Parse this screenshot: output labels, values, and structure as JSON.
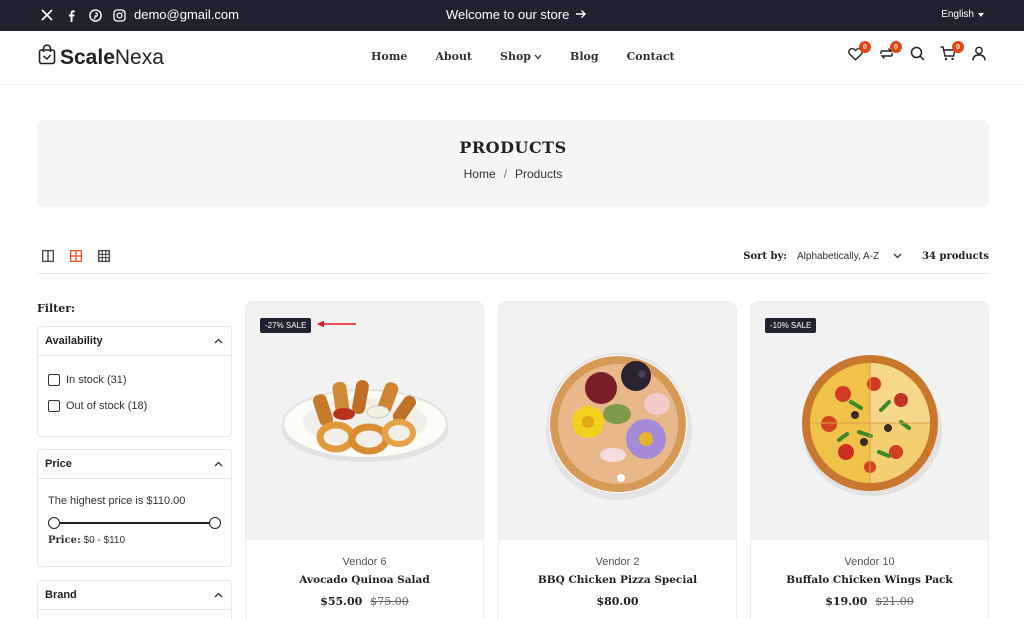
{
  "topbar": {
    "email": "demo@gmail.com",
    "welcome": "Welcome to our store",
    "language": "English",
    "social_icons": [
      "x-icon",
      "facebook-icon",
      "pinterest-icon",
      "instagram-icon"
    ]
  },
  "header": {
    "logo_bold": "Scale",
    "logo_thin": "Nexa",
    "nav": [
      "Home",
      "About",
      "Shop",
      "Blog",
      "Contact"
    ],
    "wishlist_count": "0",
    "compare_count": "0",
    "cart_count": "0"
  },
  "hero": {
    "title": "PRODUCTS",
    "crumb_home": "Home",
    "crumb_sep": "/",
    "crumb_current": "Products"
  },
  "toolbar": {
    "sort_label": "Sort by:",
    "sort_value": "Alphabetically, A-Z",
    "count": "34 products"
  },
  "sidebar": {
    "filter_label": "Filter:",
    "availability": {
      "title": "Availability",
      "in_stock": "In stock (31)",
      "out_stock": "Out of stock (18)"
    },
    "price": {
      "title": "Price",
      "highest": "The highest price is $110.00",
      "range_label": "Price:",
      "range_value": "$0 - $110"
    },
    "brand": {
      "title": "Brand"
    }
  },
  "products": [
    {
      "vendor": "Vendor 6",
      "name": "Avocado Quinoa Salad",
      "price": "$55.00",
      "old_price": "$75.00",
      "badge": "-27% SALE"
    },
    {
      "vendor": "Vendor 2",
      "name": "BBQ Chicken Pizza Special",
      "price": "$80.00",
      "old_price": "",
      "badge": ""
    },
    {
      "vendor": "Vendor 10",
      "name": "Buffalo Chicken Wings Pack",
      "price": "$19.00",
      "old_price": "$21.00",
      "badge": "-10% SALE"
    }
  ],
  "colors": {
    "dark": "#1f232f",
    "accent": "#e64512",
    "annotation": "#e0191f"
  }
}
